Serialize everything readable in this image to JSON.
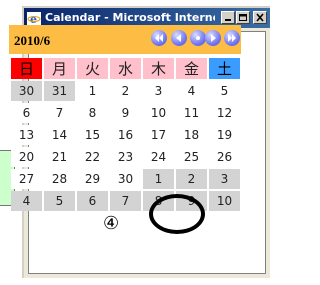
{
  "window": {
    "title": "Calendar - Microsoft Internet..."
  },
  "calendar": {
    "month_label": "2010/6",
    "weekdays": [
      "日",
      "月",
      "火",
      "水",
      "木",
      "金",
      "土"
    ],
    "weeks": [
      [
        "30",
        "31",
        "1",
        "2",
        "3",
        "4",
        "5"
      ],
      [
        "6",
        "7",
        "8",
        "9",
        "10",
        "11",
        "12"
      ],
      [
        "13",
        "14",
        "15",
        "16",
        "17",
        "18",
        "19"
      ],
      [
        "20",
        "21",
        "22",
        "23",
        "24",
        "25",
        "26"
      ],
      [
        "27",
        "28",
        "29",
        "30",
        "1",
        "2",
        "3"
      ],
      [
        "4",
        "5",
        "6",
        "7",
        "8",
        "9",
        "10"
      ]
    ],
    "nav_icons": [
      "prev-year-icon",
      "prev-month-icon",
      "today-icon",
      "next-month-icon",
      "next-year-icon"
    ]
  },
  "annotation": {
    "marker": "④",
    "highlighted_day": "24"
  },
  "colors": {
    "header_bar": "#fdbc44",
    "weekday_bg": "#ffc0cb",
    "sunday_bg": "#ff0000",
    "saturday_bg": "#3b9cff",
    "other_month_bg": "#d3d3d3",
    "nav_button": "#6a70ee"
  }
}
